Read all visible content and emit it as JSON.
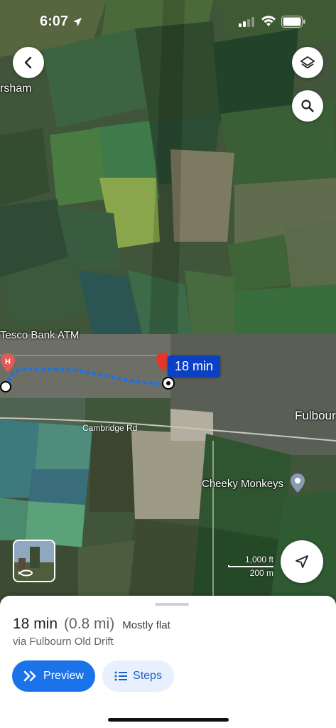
{
  "status_bar": {
    "time": "6:07",
    "icons": [
      "location-arrow-icon",
      "cellular-signal-icon",
      "wifi-icon",
      "battery-icon"
    ]
  },
  "map": {
    "labels": {
      "town_partial": "rsham",
      "tesco": "Tesco Bank ATM",
      "fulbourn": "Fulbour",
      "road": "Cambridge Rd",
      "poi": "Cheeky Monkeys"
    },
    "travel_time_badge": "18 min",
    "scale": {
      "imperial": "1,000 ft",
      "metric": "200 m"
    },
    "route_color": "#1a73e8",
    "badge_color": "#0b3fc4"
  },
  "controls": {
    "back_icon": "back-arrow-icon",
    "layers_icon": "layers-icon",
    "search_icon": "search-icon",
    "locate_icon": "navigation-arrow-icon",
    "streetview_icon": "street-view-rotate-icon"
  },
  "sheet": {
    "duration": "18 min",
    "distance": "(0.8 mi)",
    "terrain": "Mostly flat",
    "via": "via Fulbourn Old Drift",
    "preview_label": "Preview",
    "steps_label": "Steps",
    "accent": "#1a73e8"
  }
}
